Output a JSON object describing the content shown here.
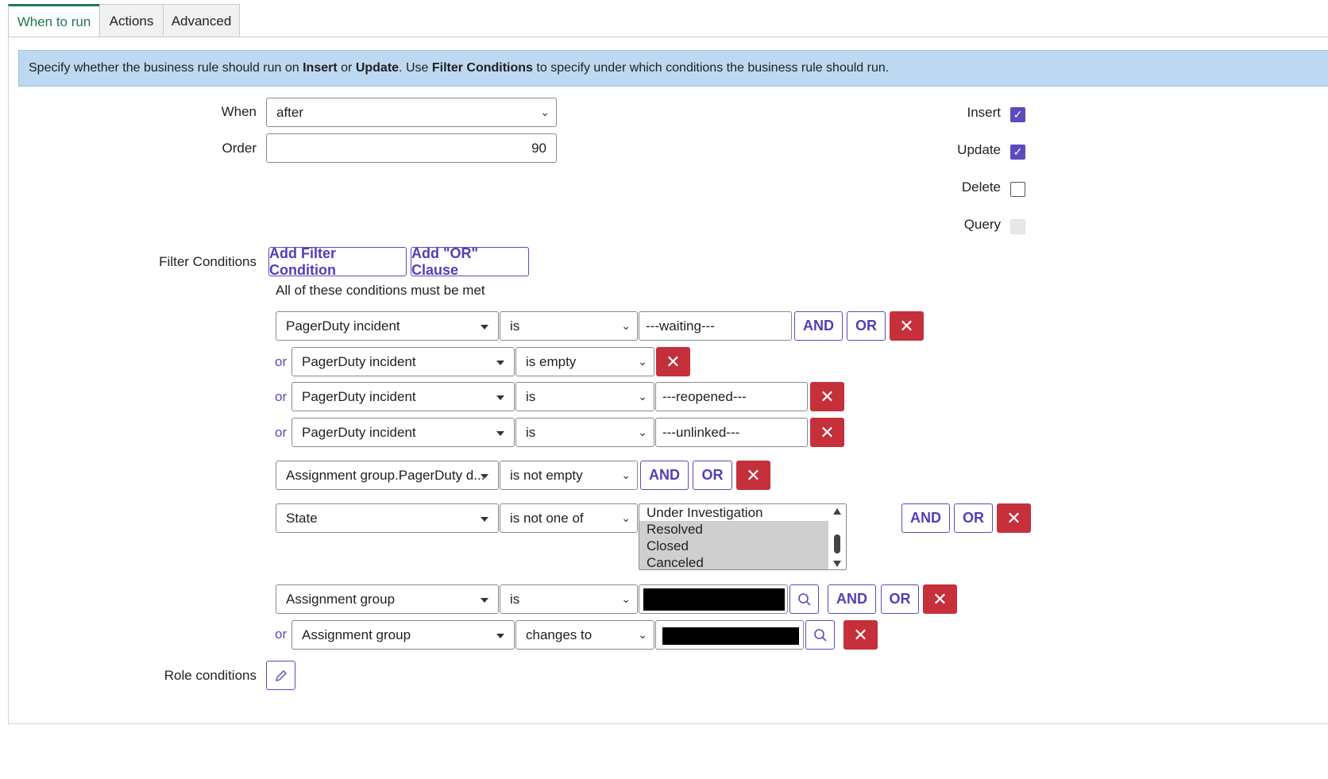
{
  "tabs": [
    "When to run",
    "Actions",
    "Advanced"
  ],
  "info": {
    "t1": "Specify whether the business rule should run on ",
    "insert": "Insert",
    "t2": " or ",
    "update": "Update",
    "t3": ". Use ",
    "filter": "Filter Conditions",
    "t4": " to specify under which conditions the business rule should run."
  },
  "form": {
    "when_label": "When",
    "when_value": "after",
    "order_label": "Order",
    "order_value": "90",
    "insert_label": "Insert",
    "insert_checked": true,
    "update_label": "Update",
    "update_checked": true,
    "delete_label": "Delete",
    "delete_checked": false,
    "query_label": "Query",
    "query_disabled": true,
    "filter_label": "Filter Conditions",
    "role_label": "Role conditions"
  },
  "filter": {
    "add_condition": "Add Filter Condition",
    "add_or": "Add \"OR\" Clause",
    "all_met": "All of these conditions must be met",
    "and": "AND",
    "or": "OR",
    "or_prefix": "or",
    "rows": [
      {
        "field": "PagerDuty incident",
        "op": "is",
        "value": "---waiting---"
      },
      {
        "field": "PagerDuty incident",
        "op": "is empty"
      },
      {
        "field": "PagerDuty incident",
        "op": "is",
        "value": "---reopened---"
      },
      {
        "field": "PagerDuty incident",
        "op": "is",
        "value": "---unlinked---"
      },
      {
        "field": "Assignment group.PagerDuty d...",
        "op": "is not empty"
      },
      {
        "field": "State",
        "op": "is not one of"
      },
      {
        "field": "Assignment group",
        "op": "is"
      },
      {
        "field": "Assignment group",
        "op": "changes to"
      }
    ],
    "state_options": [
      {
        "label": "Under Investigation",
        "selected": false
      },
      {
        "label": "Resolved",
        "selected": true
      },
      {
        "label": "Closed",
        "selected": true
      },
      {
        "label": "Canceled",
        "selected": true
      }
    ]
  },
  "colors": {
    "accent": "#5b4bbd",
    "danger": "#c5303b",
    "info_bg": "#bdd9f1",
    "active_tab": "#1e7a4e"
  }
}
